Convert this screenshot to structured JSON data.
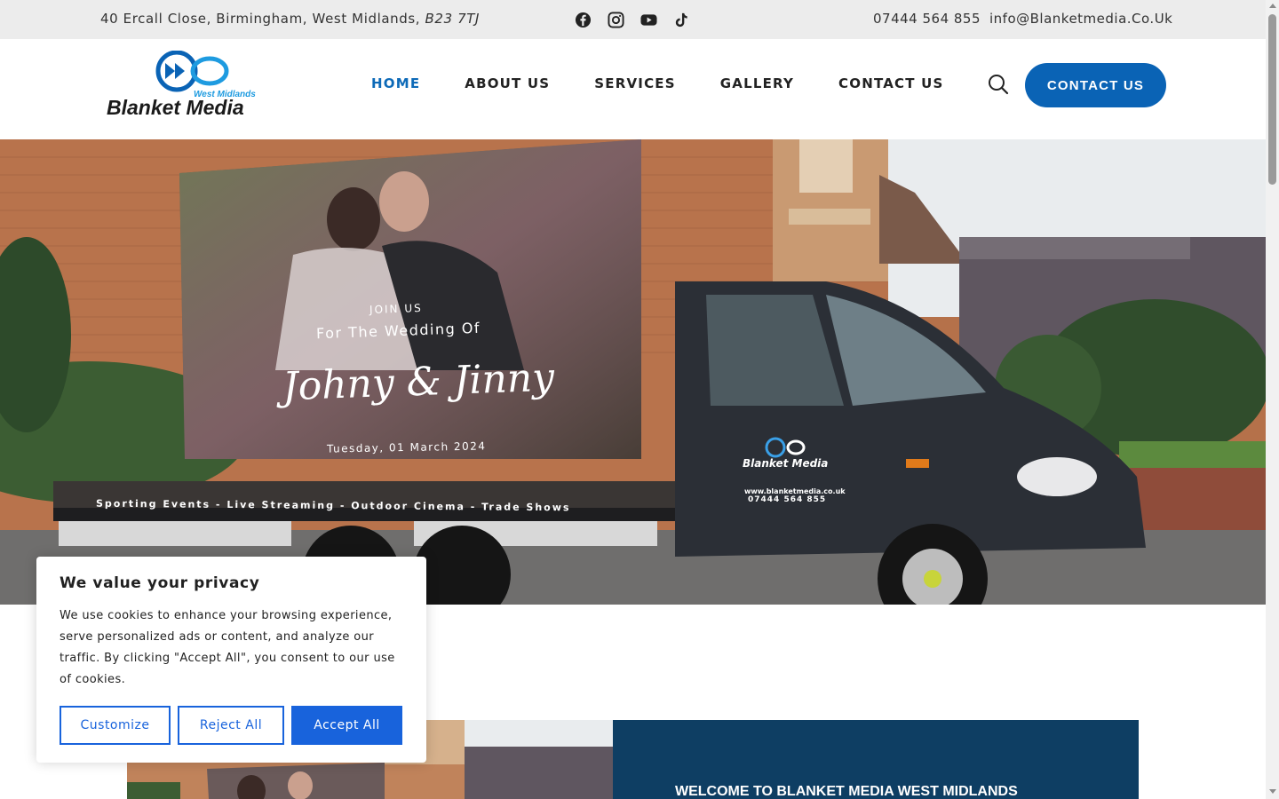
{
  "topbar": {
    "address": "40 Ercall Close, Birmingham, West Midlands, ",
    "postcode": "B23 7TJ",
    "phone": "07444 564 855",
    "email": "info@Blanketmedia.Co.Uk",
    "social": [
      "facebook-icon",
      "instagram-icon",
      "youtube-icon",
      "tiktok-icon"
    ]
  },
  "logo": {
    "tagline": "West Midlands",
    "name": "Blanket Media"
  },
  "nav": {
    "items": [
      {
        "label": "HOME"
      },
      {
        "label": "ABOUT US"
      },
      {
        "label": "SERVICES"
      },
      {
        "label": "GALLERY"
      },
      {
        "label": "CONTACT US"
      }
    ],
    "cta_label": "CONTACT US"
  },
  "hero": {
    "join": "JOIN US",
    "wedding_of": "For The Wedding Of",
    "names": "Johny & Jinny",
    "date": "Tuesday, 01 March 2024",
    "strip": "Sporting Events  -  Live Streaming  -  Outdoor Cinema  -  Trade Shows",
    "door_brand": "Blanket Media",
    "door_url": "www.blanketmedia.co.uk",
    "door_phone": "07444 564 855"
  },
  "welcome": {
    "title": "WELCOME TO BLANKET MEDIA WEST MIDLANDS"
  },
  "cookie": {
    "title": "We value your privacy",
    "text": "We use cookies to enhance your browsing experience, serve personalized ads or content, and analyze our traffic. By clicking \"Accept All\", you consent to our use of cookies.",
    "customize": "Customize",
    "reject": "Reject All",
    "accept": "Accept All"
  },
  "colors": {
    "brand_blue": "#0a63b5",
    "nav_active": "#0d6ab8",
    "cookie_blue": "#1863dc",
    "welcome_bg": "#0e3e63",
    "topbar_bg": "#ececec"
  }
}
